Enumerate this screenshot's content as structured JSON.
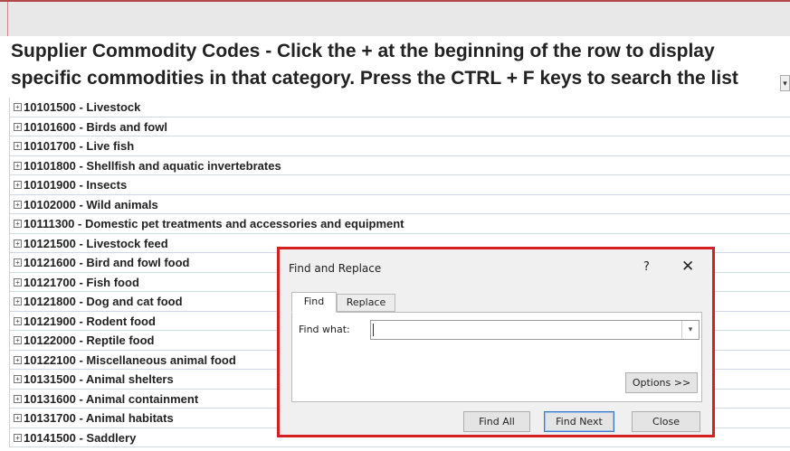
{
  "heading": {
    "line1": "Supplier Commodity Codes - Click the + at the beginning of the row to display",
    "line2": "specific commodities in that category.  Press the CTRL + F keys to search the list"
  },
  "rows": [
    "10101500 - Livestock",
    "10101600 - Birds and fowl",
    "10101700 - Live fish",
    "10101800 - Shellfish and aquatic invertebrates",
    "10101900 - Insects",
    "10102000 - Wild animals",
    "10111300 - Domestic pet treatments and accessories and equipment",
    "10121500 - Livestock feed",
    "10121600 - Bird and fowl food",
    "10121700 - Fish food",
    "10121800 - Dog and cat food",
    "10121900 - Rodent food",
    "10122000 - Reptile food",
    "10122100 - Miscellaneous animal food",
    "10131500 - Animal shelters",
    "10131600 - Animal containment",
    "10131700 - Animal habitats",
    "10141500 - Saddlery"
  ],
  "dialog": {
    "title": "Find and Replace",
    "help": "?",
    "close": "✕",
    "tabs": {
      "find": "Find",
      "replace": "Replace"
    },
    "find_label": "Find what:",
    "find_value": "",
    "options_button": "Options >>",
    "find_all_button": "Find All",
    "find_next_button": "Find Next",
    "close_button": "Close"
  },
  "colors": {
    "highlight_border": "#d42020",
    "row_line": "#cfd8e6"
  }
}
